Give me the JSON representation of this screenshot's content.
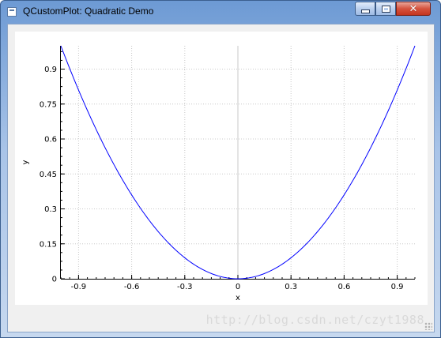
{
  "window": {
    "title": "QCustomPlot: Quadratic Demo",
    "icons": {
      "app": "app-icon",
      "minimize": "minimize-icon",
      "maximize": "maximize-icon",
      "close": "close-icon"
    },
    "close_glyph": "✕"
  },
  "watermark": "http://blog.csdn.net/czyt1988",
  "colors": {
    "curve": "#0000ff",
    "grid": "#c8c8c8",
    "zero_line": "#c8c8c8",
    "axis": "#000000"
  },
  "chart_data": {
    "type": "line",
    "function": "y = x^2",
    "xlabel": "x",
    "ylabel": "y",
    "xlim": [
      -1,
      1
    ],
    "ylim": [
      0,
      1
    ],
    "x_ticks": [
      -0.9,
      -0.6,
      -0.3,
      0,
      0.3,
      0.6,
      0.9
    ],
    "x_tick_labels": [
      "-0.9",
      "-0.6",
      "-0.3",
      "0",
      "0.3",
      "0.6",
      "0.9"
    ],
    "y_ticks": [
      0,
      0.15,
      0.3,
      0.45,
      0.6,
      0.75,
      0.9
    ],
    "y_tick_labels": [
      "0",
      "0.15",
      "0.3",
      "0.45",
      "0.6",
      "0.75",
      "0.9"
    ],
    "grid": true,
    "series": [
      {
        "x": [
          -1,
          -0.9,
          -0.8,
          -0.7,
          -0.6,
          -0.5,
          -0.4,
          -0.3,
          -0.2,
          -0.1,
          0,
          0.1,
          0.2,
          0.3,
          0.4,
          0.5,
          0.6,
          0.7,
          0.8,
          0.9,
          1
        ],
        "y": [
          1,
          0.81,
          0.64,
          0.49,
          0.36,
          0.25,
          0.16,
          0.09,
          0.04,
          0.01,
          0,
          0.01,
          0.04,
          0.09,
          0.16,
          0.25,
          0.36,
          0.49,
          0.64,
          0.81,
          1
        ]
      }
    ]
  }
}
